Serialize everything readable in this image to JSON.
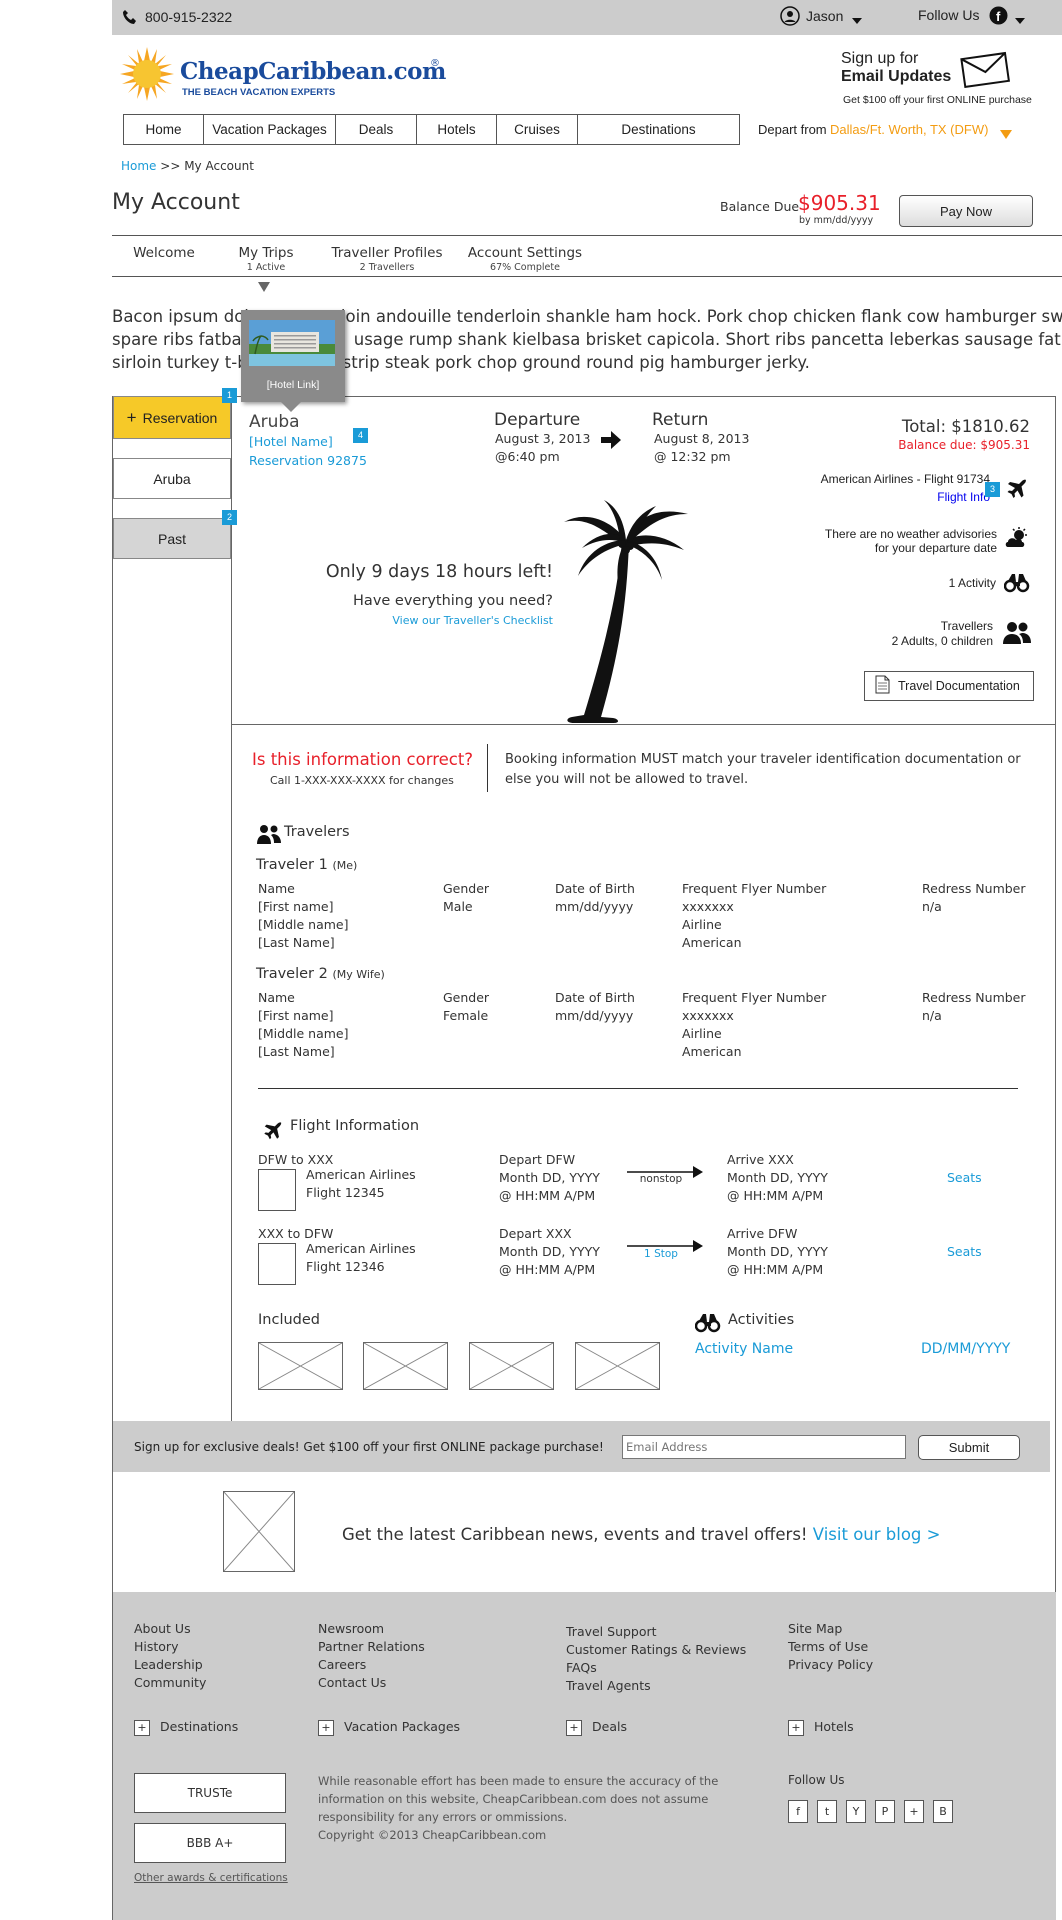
{
  "header": {
    "phone": "800-915-2322",
    "user_name": "Jason",
    "follow_us": "Follow Us",
    "logo_text": "CheapCaribbean.com",
    "logo_tagline": "THE BEACH VACATION EXPERTS",
    "signup_line1": "Sign up for",
    "signup_line2": "Email Updates",
    "signup_line3": "Get $100 off your first ONLINE purchase"
  },
  "nav": {
    "items": [
      "Home",
      "Vacation Packages",
      "Deals",
      "Hotels",
      "Cruises",
      "Destinations"
    ],
    "depart_label": "Depart from",
    "depart_value": "Dallas/Ft. Worth, TX (DFW)"
  },
  "breadcrumb": {
    "home": "Home",
    "sep": ">>",
    "current": "My Account"
  },
  "account": {
    "title": "My Account",
    "balance_label": "Balance Due",
    "balance_value": "$905.31",
    "balance_by": "by mm/dd/yyyy",
    "pay_now": "Pay Now"
  },
  "tabs": [
    {
      "label": "Welcome",
      "sub": ""
    },
    {
      "label": "My Trips",
      "sub": "1 Active"
    },
    {
      "label": "Traveller Profiles",
      "sub": "2 Travellers"
    },
    {
      "label": "Account Settings",
      "sub": "67% Complete"
    }
  ],
  "intro": {
    "line1a": "Bacon ipsum dol",
    "line1b": "loin andouille tenderloin shankle ham hock. Pork chop chicken flank cow hamburger swine",
    "line2a": "spare ribs fatbac",
    "line2b": "usage rump shank kielbasa brisket capicola. Short ribs pancetta leberkas sausage fatback",
    "line3a": "sirloin turkey t-b",
    "line3b": "strip steak pork chop ground round pig hamburger jerky."
  },
  "hotel_popup": {
    "label": "[Hotel Link]"
  },
  "sidebar": {
    "reservation": "Reservation",
    "aruba": "Aruba",
    "past": "Past"
  },
  "badges": [
    "1",
    "2",
    "3",
    "4"
  ],
  "trip": {
    "destination": "Aruba",
    "hotel_name": "[Hotel Name]",
    "reservation": "Reservation 92875",
    "departure_label": "Departure",
    "departure_date": "August 3, 2013",
    "departure_time": "@6:40 pm",
    "return_label": "Return",
    "return_date": "August 8, 2013",
    "return_time": "@ 12:32 pm",
    "total": "Total: $1810.62",
    "balance_due": "Balance due: $905.31",
    "airline": "American Airlines - Flight 91734",
    "flight_info": "Flight Info",
    "weather1": "There are no weather advisories",
    "weather2": "for your departure date",
    "activity": "1 Activity",
    "travellers_label": "Travellers",
    "travellers_value": "2 Adults, 0 children",
    "documentation": "Travel Documentation",
    "countdown": "Only 9 days 18 hours left!",
    "have_everything": "Have everything you need?",
    "checklist": "View our Traveller's Checklist"
  },
  "notice": {
    "question": "Is this information correct?",
    "call": "Call 1-XXX-XXX-XXXX for changes",
    "text1": "Booking information MUST match your traveler identification documentation or",
    "text2": "else you will not be allowed to travel."
  },
  "travelers": {
    "heading": "Travelers",
    "columns": [
      "Name",
      "Gender",
      "Date of Birth",
      "Frequent Flyer Number",
      "Redress Number"
    ],
    "list": [
      {
        "title": "Traveler 1",
        "relation": "(Me)",
        "first": "[First name]",
        "middle": "[Middle name]",
        "last": "[Last Name]",
        "gender": "Male",
        "dob": "mm/dd/yyyy",
        "ff": "xxxxxxx",
        "airline_label": "Airline",
        "airline": "American",
        "redress": "n/a"
      },
      {
        "title": "Traveler 2",
        "relation": "(My Wife)",
        "first": "[First name]",
        "middle": "[Middle name]",
        "last": "[Last Name]",
        "gender": "Female",
        "dob": "mm/dd/yyyy",
        "ff": "xxxxxxx",
        "airline_label": "Airline",
        "airline": "American",
        "redress": "n/a"
      }
    ]
  },
  "flights": {
    "heading": "Flight Information",
    "list": [
      {
        "route": "DFW to XXX",
        "airline": "American Airlines",
        "flight": "Flight 12345",
        "depart": "Depart DFW",
        "depart_date": "Month DD, YYYY",
        "depart_time": "@ HH:MM A/PM",
        "stops": "nonstop",
        "arrive": "Arrive XXX",
        "arrive_date": "Month DD, YYYY",
        "arrive_time": "@ HH:MM A/PM",
        "seats": "Seats"
      },
      {
        "route": "XXX to DFW",
        "airline": "American Airlines",
        "flight": "Flight 12346",
        "depart": "Depart XXX",
        "depart_date": "Month DD, YYYY",
        "depart_time": "@ HH:MM A/PM",
        "stops": "1 Stop",
        "arrive": "Arrive DFW",
        "arrive_date": "Month DD, YYYY",
        "arrive_time": "@ HH:MM A/PM",
        "seats": "Seats"
      }
    ]
  },
  "included": {
    "heading": "Included"
  },
  "activities": {
    "heading": "Activities",
    "name": "Activity Name",
    "date": "DD/MM/YYYY"
  },
  "newsletter": {
    "text": "Sign up for exclusive deals! Get $100 off your first ONLINE package purchase!",
    "placeholder": "Email Address",
    "submit": "Submit"
  },
  "blog": {
    "text": "Get the latest Caribbean news, events and travel offers!",
    "link": "Visit our blog >"
  },
  "footer": {
    "col1": [
      "About Us",
      "History",
      "Leadership",
      "Community"
    ],
    "col2": [
      "Newsroom",
      "Partner Relations",
      "Careers",
      "Contact Us"
    ],
    "col3": [
      "Travel Support",
      "Customer Ratings & Reviews",
      "FAQs",
      "Travel Agents"
    ],
    "col4": [
      "Site Map",
      "Terms of Use",
      "Privacy Policy"
    ],
    "expanders": [
      "Destinations",
      "Vacation Packages",
      "Deals",
      "Hotels"
    ],
    "truste": "TRUSTe",
    "bbb": "BBB A+",
    "awards": "Other awards & certifications",
    "disclaimer1": "While reasonable effort has been made to ensure the accuracy of the",
    "disclaimer2": "information on this website, CheapCaribbean.com does not assume",
    "disclaimer3": "responsibility for any errors or ommissions.",
    "copyright": "Copyright ©2013 CheapCaribbean.com",
    "follow": "Follow Us",
    "social": [
      "f",
      "t",
      "Y",
      "P",
      "+",
      "B"
    ]
  },
  "colors": {
    "accent": "#1a9bd7",
    "price_red": "#e8202a",
    "depart_orange": "#f39c12",
    "reservation_yellow": "#f6c928",
    "gray_bar": "#cccccc"
  }
}
